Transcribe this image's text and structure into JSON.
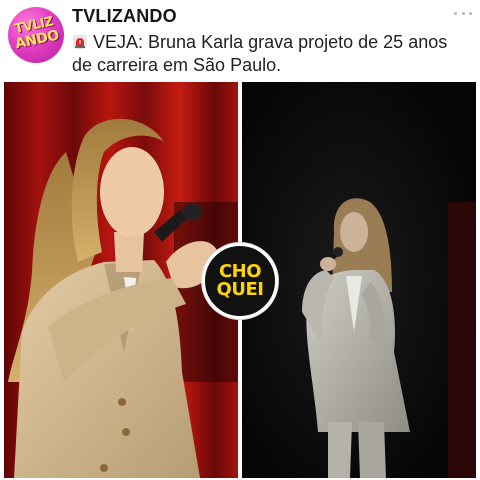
{
  "post": {
    "avatar_text_line1": "TVLIZ",
    "avatar_text_line2": "ANDO",
    "username": "TVLIZANDO",
    "caption_prefix": "VEJA:",
    "caption_text": " Bruna Karla grava projeto de 25 anos de carreira em São Paulo.",
    "menu_icon": "more-horizontal-icon",
    "caption_icon": "siren-icon"
  },
  "media": {
    "badge_line1": "CHO",
    "badge_line2": "QUEI"
  },
  "colors": {
    "avatar_bg": "#e33fc4",
    "logo_text": "#ffe45c",
    "badge_text": "#ffd400",
    "left_panel_bg": "#7a0b0b",
    "right_panel_bg": "#060606"
  }
}
